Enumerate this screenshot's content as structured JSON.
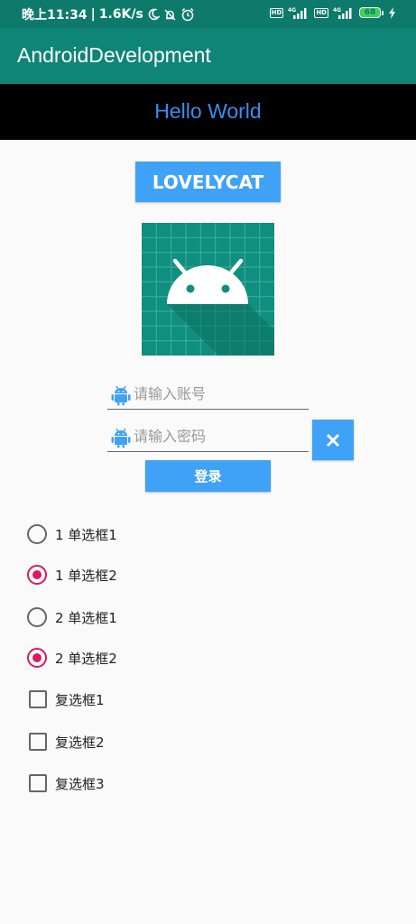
{
  "status_bar": {
    "time": "晚上11:34",
    "speed": "1.6K/s",
    "network_type_1": "4G",
    "network_type_2": "4G",
    "hd_1": "HD",
    "hd_2": "HD",
    "battery": "68",
    "icons": [
      "moon-icon",
      "mute-bell-icon",
      "alarm-icon",
      "signal-icon",
      "charging-icon"
    ]
  },
  "app_bar": {
    "title": "AndroidDevelopment"
  },
  "hello": {
    "text": "Hello World",
    "color": "#3d8cf0"
  },
  "main_button": {
    "label": "LOVELYCAT"
  },
  "logo": {
    "icon": "android-logo-icon",
    "background": "#0f8f7f"
  },
  "account_field": {
    "placeholder": "请输入账号",
    "value": "",
    "icon": "android-icon"
  },
  "password_field": {
    "placeholder": "请输入密码",
    "value": "",
    "icon": "android-icon"
  },
  "clear_button": {
    "icon": "close-icon"
  },
  "login_button": {
    "label": "登录"
  },
  "radio_options": [
    {
      "label": "1 单选框1",
      "checked": false
    },
    {
      "label": "1 单选框2",
      "checked": true
    },
    {
      "label": "2 单选框1",
      "checked": false
    },
    {
      "label": "2 单选框2",
      "checked": true
    }
  ],
  "checkbox_options": [
    {
      "label": "复选框1",
      "checked": false
    },
    {
      "label": "复选框2",
      "checked": false
    },
    {
      "label": "复选框3",
      "checked": false
    }
  ],
  "colors": {
    "status_bar": "#0e7a6b",
    "app_bar": "#0e8576",
    "accent_blue": "#3fa2f7",
    "radio_checked": "#d81b60"
  }
}
